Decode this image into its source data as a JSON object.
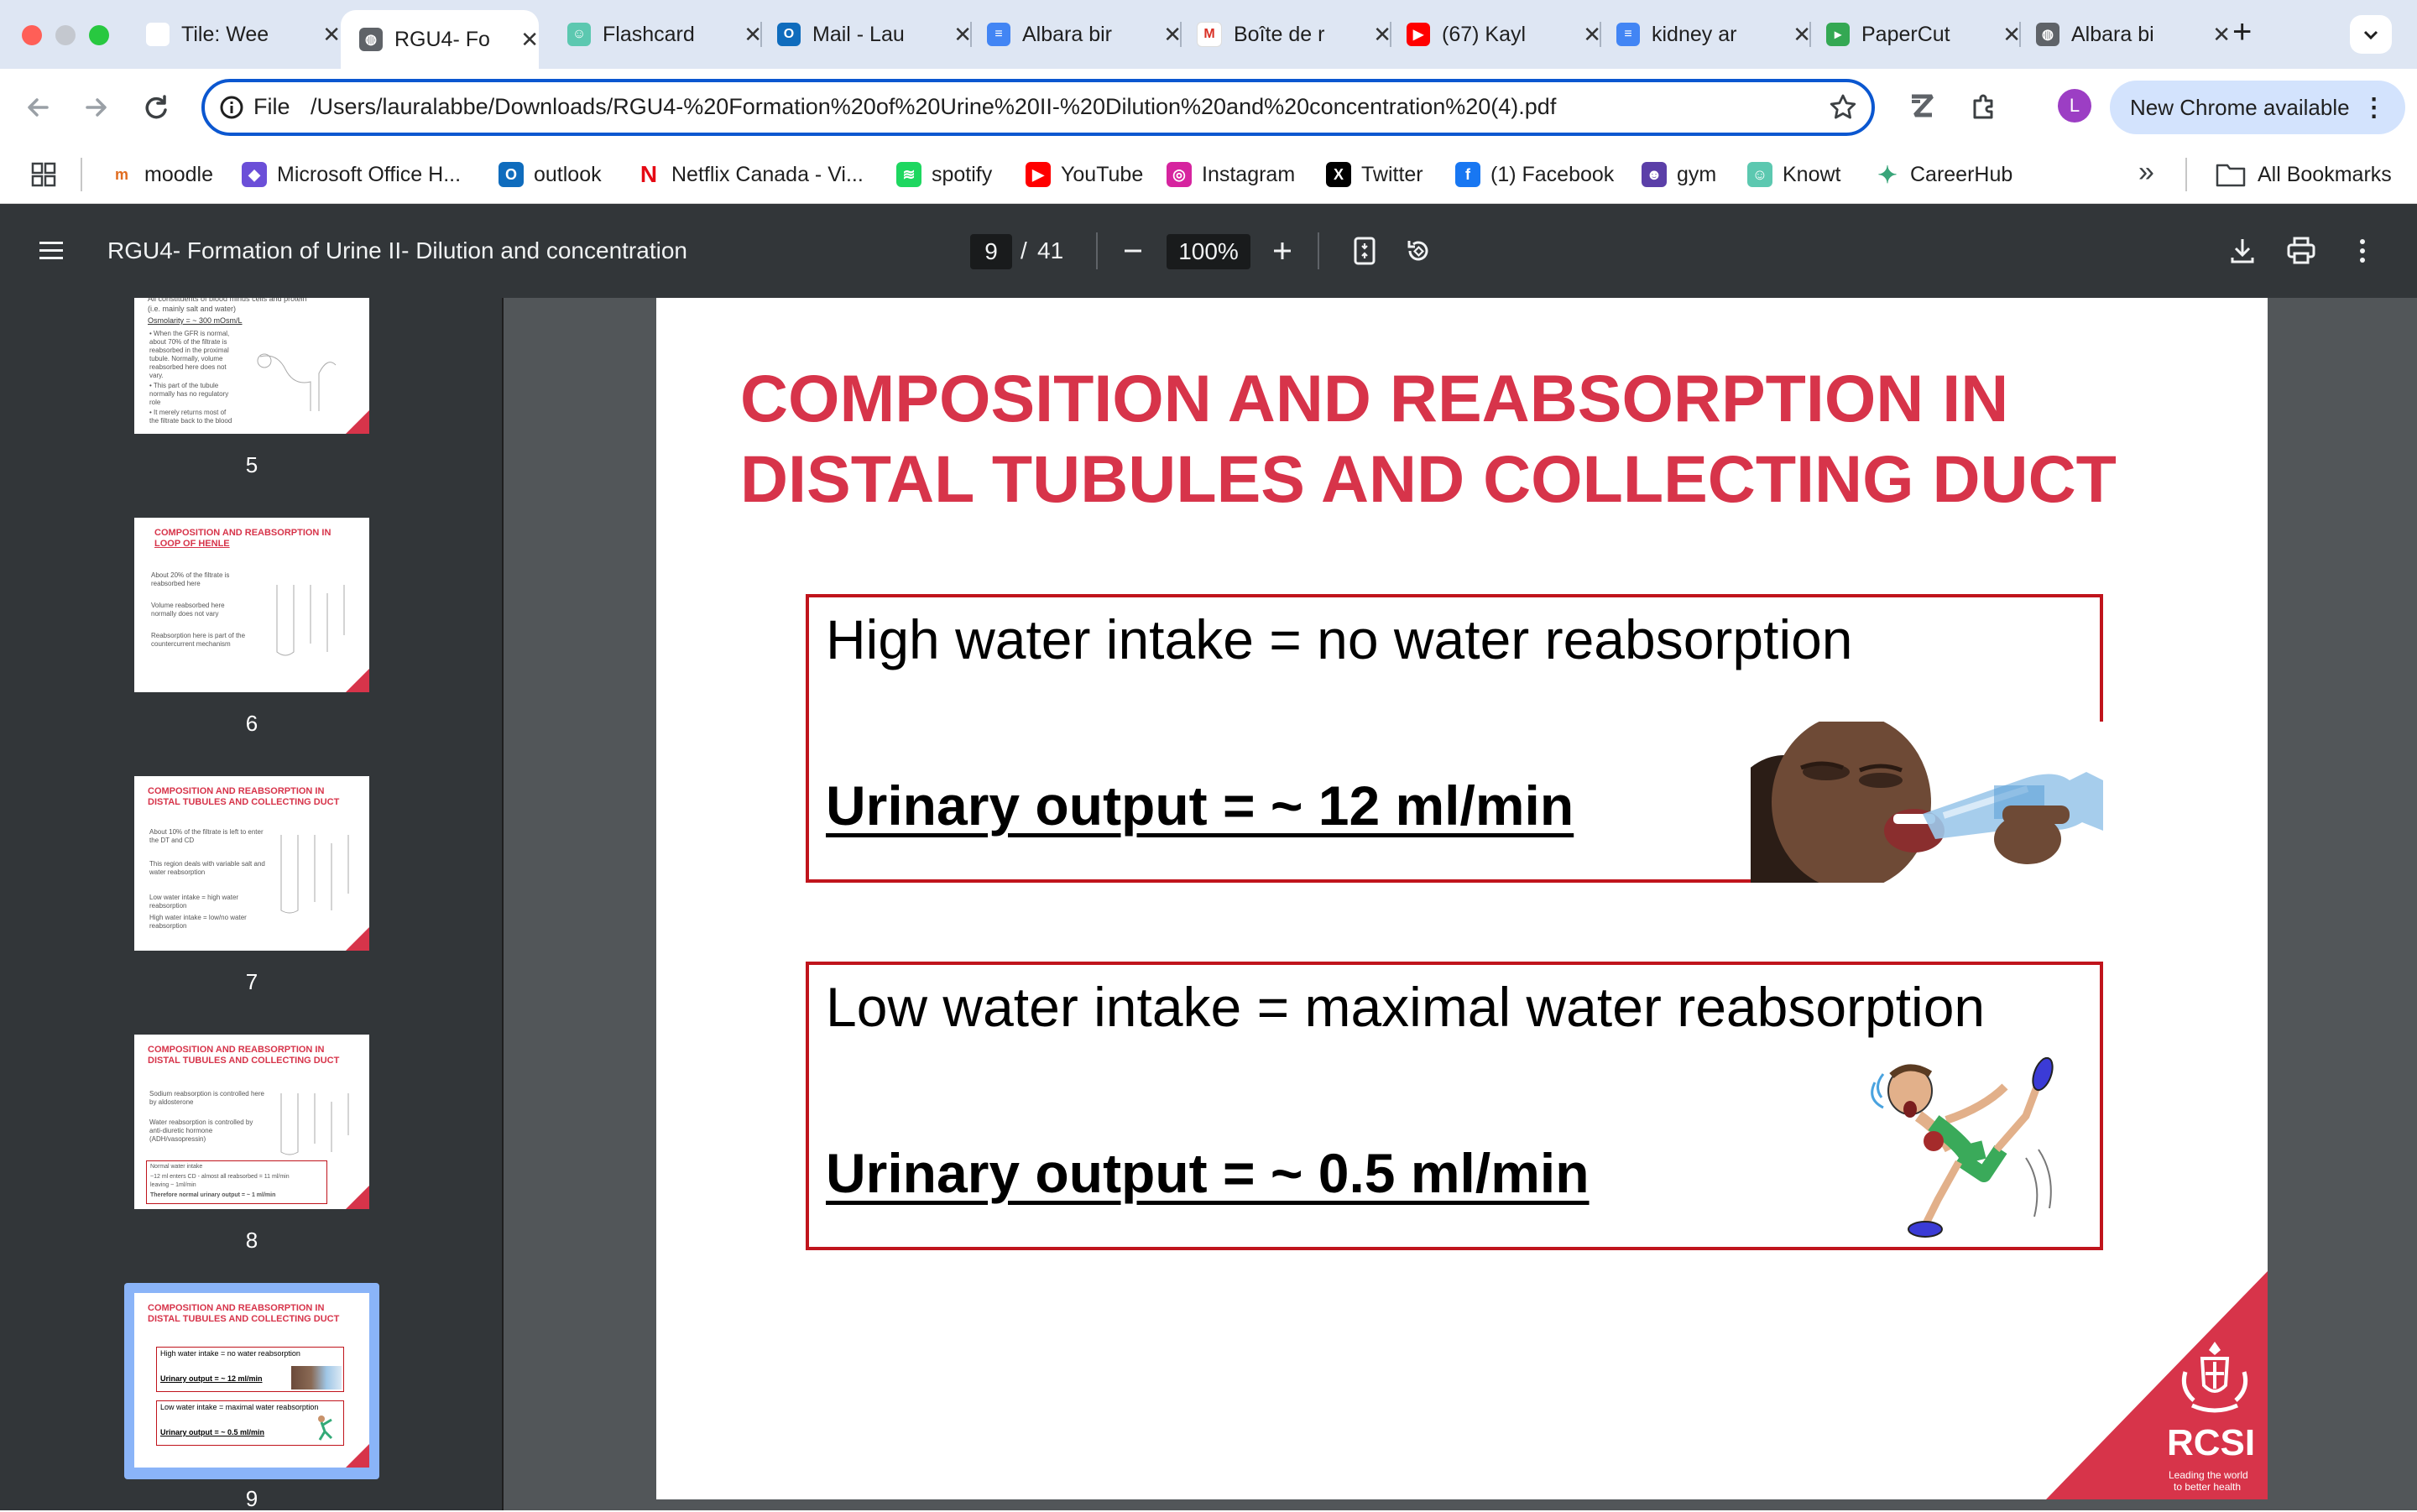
{
  "browser": {
    "tabs": [
      {
        "title": "Tile: Wee",
        "icon": "rcsi-favicon"
      },
      {
        "title": "RGU4- Fo",
        "icon": "globe-icon",
        "active": true
      },
      {
        "title": "Flashcard",
        "icon": "knowt-icon"
      },
      {
        "title": "Mail - Lau",
        "icon": "outlook-icon"
      },
      {
        "title": "Albara bir",
        "icon": "docs-icon"
      },
      {
        "title": "Boîte de r",
        "icon": "gmail-icon"
      },
      {
        "title": "(67) Kayl",
        "icon": "youtube-icon"
      },
      {
        "title": "kidney ar",
        "icon": "docs-icon"
      },
      {
        "title": "PaperCut",
        "icon": "papercut-icon"
      },
      {
        "title": "Albara bi",
        "icon": "globe-icon"
      }
    ],
    "new_tab_symbol": "+",
    "close_symbol": "✕",
    "omnibox": {
      "scheme_label": "File",
      "url": "/Users/lauralabbe/Downloads/RGU4-%20Formation%20of%20Urine%20II-%20Dilution%20and%20concentration%20(4).pdf"
    },
    "profile_initial": "L",
    "update_label": "New Chrome available",
    "bookmarks": [
      {
        "label": "moodle",
        "icon": "moodle-icon",
        "color": "#e06c1f"
      },
      {
        "label": "Microsoft Office H...",
        "icon": "office-icon",
        "color": "#6b4fd8"
      },
      {
        "label": "outlook",
        "icon": "outlook-icon",
        "color": "#0f6cbd"
      },
      {
        "label": "Netflix Canada - Vi...",
        "icon": "netflix-icon",
        "color": "#e50914"
      },
      {
        "label": "spotify",
        "icon": "spotify-icon",
        "color": "#1ed760"
      },
      {
        "label": "YouTube",
        "icon": "youtube-icon",
        "color": "#ff0000"
      },
      {
        "label": "Instagram",
        "icon": "instagram-icon",
        "color": "#d6249f"
      },
      {
        "label": "Twitter",
        "icon": "x-icon",
        "color": "#000000"
      },
      {
        "label": "(1) Facebook",
        "icon": "facebook-icon",
        "color": "#1877f2"
      },
      {
        "label": "gym",
        "icon": "gym-icon",
        "color": "#5b3fa8"
      },
      {
        "label": "Knowt",
        "icon": "knowt-icon",
        "color": "#5cc8b0"
      },
      {
        "label": "CareerHub",
        "icon": "careerhub-icon",
        "color": "#3aa57a"
      }
    ],
    "more_bookmarks": "»",
    "all_bookmarks_label": "All Bookmarks"
  },
  "pdf": {
    "title": "RGU4- Formation of Urine II- Dilution and concentration",
    "current_page": "9",
    "page_separator": "/",
    "total_pages": "41",
    "zoom": "100%",
    "thumbnails": [
      {
        "page": "5"
      },
      {
        "page": "6"
      },
      {
        "page": "7"
      },
      {
        "page": "8"
      },
      {
        "page": "9",
        "selected": true
      }
    ],
    "thumb_text": {
      "t5_lines": [
        "All constituents of blood minus cells and protein",
        "(i.e. mainly salt and water)",
        "Osmolarity = ~ 300 mOsm/L",
        "• When the GFR is normal,",
        "about 70% of the filtrate is",
        "reabsorbed in the proximal",
        "tubule. Normally, volume",
        "reabsorbed here does not",
        "vary.",
        "• This part of the tubule",
        "normally has no regulatory",
        "role",
        "• It merely returns most of",
        "the filtrate back to the blood"
      ],
      "t6_title": [
        "COMPOSITION AND REABSORPTION IN",
        "LOOP OF HENLE"
      ],
      "t6_lines": [
        "About 20% of the filtrate is reabsorbed here",
        "Volume reabsorbed here normally does not vary",
        "Reabsorption here is part of the countercurrent mechanism"
      ],
      "t7_title": [
        "COMPOSITION AND REABSORPTION IN",
        "DISTAL TUBULES AND COLLECTING DUCT"
      ],
      "t7_lines": [
        "About 10% of the filtrate is left to enter the DT and CD",
        "This region deals with variable salt and water reabsorption",
        "Low water intake = high water reabsorption",
        "High water intake = low/no water reabsorption"
      ],
      "t8_title": [
        "COMPOSITION AND REABSORPTION IN",
        "DISTAL TUBULES AND COLLECTING DUCT"
      ],
      "t8_lines": [
        "Sodium reabsorption is controlled here by aldosterone",
        "Water reabsorption is controlled by anti-diuretic hormone (ADH/vasopressin)",
        "Normal water intake",
        "~12 ml enters CD - almost all reabsorbed = 11 ml/min",
        "leaving ~ 1ml/min",
        "Therefore normal urinary output = ~ 1 ml/min"
      ]
    }
  },
  "slide": {
    "title_line1": "COMPOSITION AND REABSORPTION IN",
    "title_line2": "DISTAL TUBULES AND COLLECTING DUCT",
    "box1_statement": "High water intake = no water reabsorption",
    "box1_output": "Urinary output = ~ 12 ml/min",
    "box2_statement": "Low water intake = maximal water reabsorption",
    "box2_output": "Urinary output = ~ 0.5 ml/min",
    "logo_text": "RCSI",
    "logo_tagline_1": "Leading the world",
    "logo_tagline_2": "to better health",
    "accent_color": "#d7344a",
    "box_border_color": "#c0141c"
  }
}
